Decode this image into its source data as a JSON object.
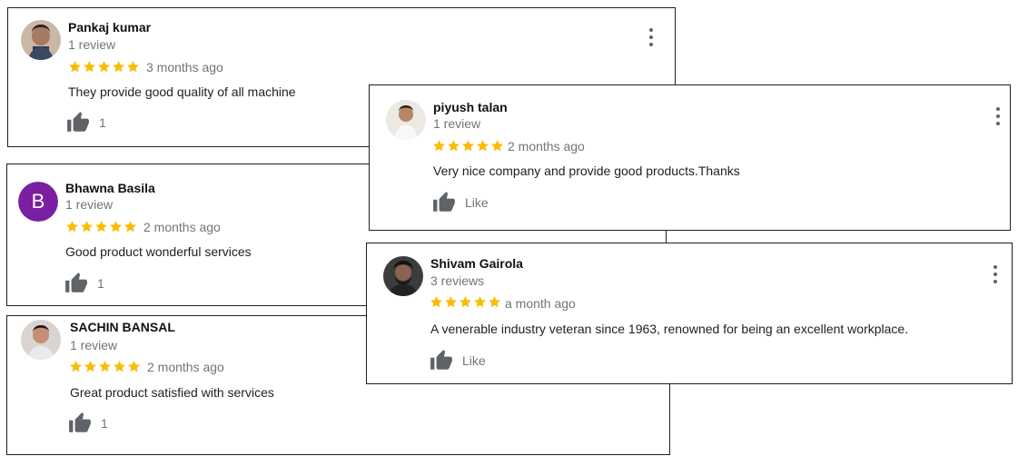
{
  "reviews": [
    {
      "name": "Pankaj kumar",
      "review_count": "1 review",
      "rating": 5,
      "time": "3 months ago",
      "text": "They provide good quality of all machine",
      "likes": "1",
      "avatar": "photo"
    },
    {
      "name": "Bhawna Basila",
      "review_count": "1 review",
      "rating": 5,
      "time": "2 months ago",
      "text": "Good product wonderful services",
      "likes": "1",
      "avatar_letter": "B",
      "avatar_color": "#7b1fa2"
    },
    {
      "name": "SACHIN BANSAL",
      "review_count": "1 review",
      "rating": 5,
      "time": "2 months ago",
      "text": "Great product satisfied with services",
      "likes": "1",
      "avatar": "photo"
    },
    {
      "name": "piyush talan",
      "review_count": "1 review",
      "rating": 5,
      "time": "2 months ago",
      "text": "Very nice company and provide good products.Thanks",
      "likes": "Like",
      "avatar": "photo"
    },
    {
      "name": "Shivam Gairola",
      "review_count": "3 reviews",
      "rating": 5,
      "time": "a month ago",
      "text": "A venerable industry veteran since 1963, renowned for being an excellent workplace.",
      "likes": "Like",
      "avatar": "photo"
    }
  ],
  "colors": {
    "star": "#fbbc04",
    "thumb": "#5f6368",
    "muted": "#70757a"
  },
  "icons": {
    "like": "thumbs-up-icon",
    "menu": "more-vert-icon",
    "rating": "star-icon"
  }
}
